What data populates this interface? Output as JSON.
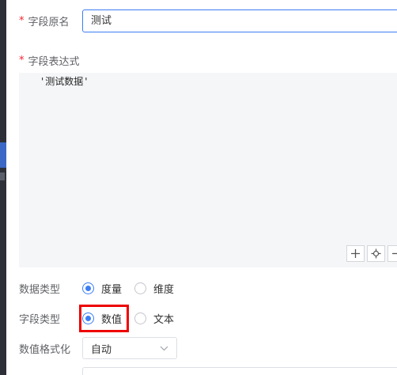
{
  "field_original_name": {
    "label": "字段原名",
    "required_mark": "*",
    "value": "测试"
  },
  "field_expression": {
    "label": "字段表达式",
    "required_mark": "*",
    "value": "'测试数据'"
  },
  "expression_tools": [
    "plus-icon",
    "target-icon",
    "minus-icon"
  ],
  "data_type": {
    "label": "数据类型",
    "options": [
      "度量",
      "维度"
    ],
    "selected": "度量"
  },
  "field_type": {
    "label": "字段类型",
    "options": [
      "数值",
      "文本"
    ],
    "selected": "数值"
  },
  "number_format": {
    "label": "数值格式化",
    "value": "自动"
  },
  "colors": {
    "accent": "#3b7ef4",
    "required": "#f5222d",
    "highlight_box": "#ee0000"
  }
}
